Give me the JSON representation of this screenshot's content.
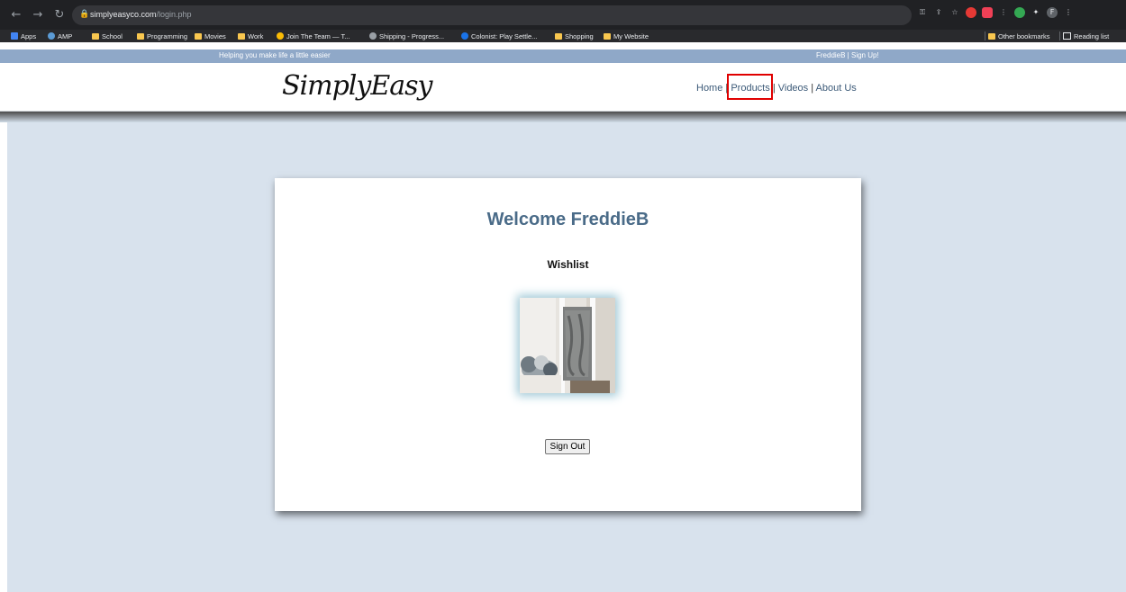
{
  "browser": {
    "url_host": "simplyeasyco.com",
    "url_path": "/login.php",
    "bookmarks": [
      {
        "label": "Apps",
        "type": "apps"
      },
      {
        "label": "AMP",
        "type": "site"
      },
      {
        "label": "School",
        "type": "folder"
      },
      {
        "label": "Programming",
        "type": "folder"
      },
      {
        "label": "Movies",
        "type": "folder"
      },
      {
        "label": "Work",
        "type": "folder"
      },
      {
        "label": "Join The Team — T...",
        "type": "site"
      },
      {
        "label": "Shipping - Progress...",
        "type": "site"
      },
      {
        "label": "Colonist: Play Settle...",
        "type": "site"
      },
      {
        "label": "Shopping",
        "type": "folder"
      },
      {
        "label": "My Website",
        "type": "folder"
      }
    ],
    "other_bookmarks": "Other bookmarks",
    "reading_list": "Reading list"
  },
  "site": {
    "tagline": "Helping you make life a little easier",
    "user_links": "FreddieB | Sign Up!",
    "logo": "SimplyEasy",
    "nav": [
      {
        "label": "Home"
      },
      {
        "label": "Products"
      },
      {
        "label": "Videos"
      },
      {
        "label": "About Us"
      }
    ]
  },
  "card": {
    "welcome": "Welcome FreddieB",
    "wishlist_heading": "Wishlist",
    "signout_label": "Sign Out"
  },
  "colors": {
    "topbar": "#8fa8c8",
    "page_bg": "#d8e2ed",
    "heading": "#4a6b88",
    "highlight": "#e00000"
  }
}
